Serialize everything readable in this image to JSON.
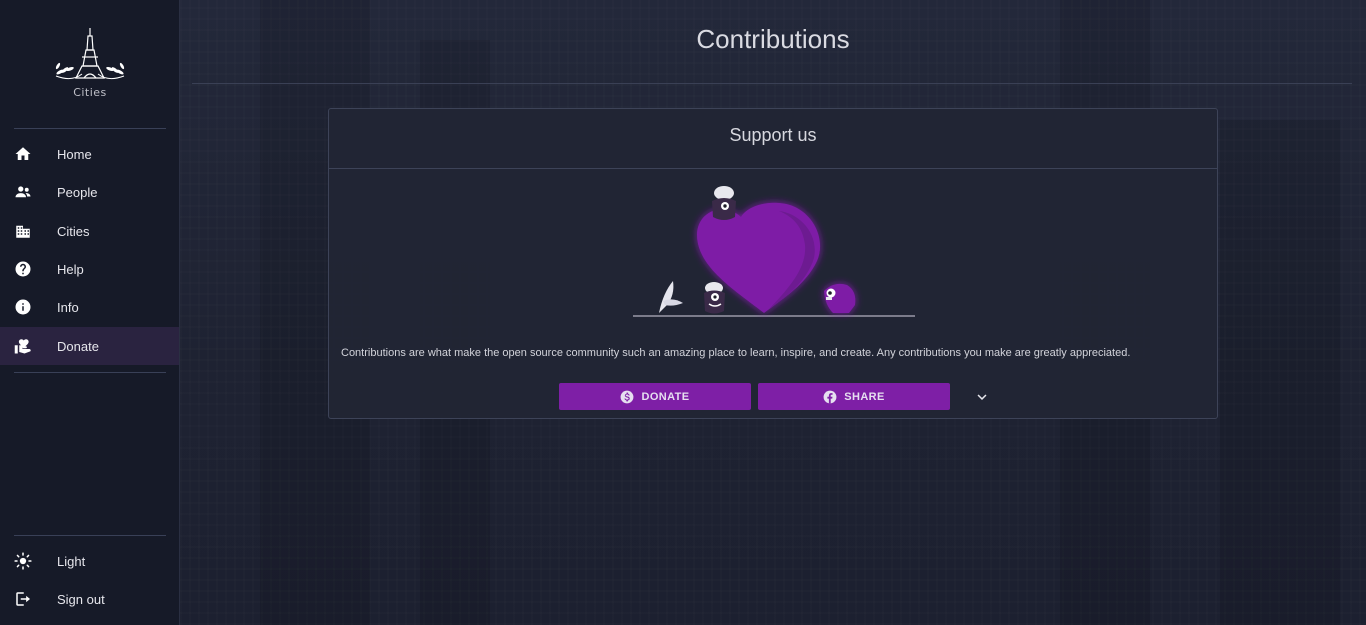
{
  "app": {
    "logo_text": "Cities"
  },
  "sidebar": {
    "items": [
      {
        "label": "Home",
        "icon": "home-icon"
      },
      {
        "label": "People",
        "icon": "people-icon"
      },
      {
        "label": "Cities",
        "icon": "city-icon"
      },
      {
        "label": "Help",
        "icon": "help-icon"
      },
      {
        "label": "Info",
        "icon": "info-icon"
      },
      {
        "label": "Donate",
        "icon": "donate-icon",
        "active": true
      }
    ],
    "bottom_items": [
      {
        "label": "Light",
        "icon": "sun-icon"
      },
      {
        "label": "Sign out",
        "icon": "sign-out-icon"
      }
    ]
  },
  "main": {
    "title": "Contributions",
    "card": {
      "title": "Support us",
      "text": "Contributions are what make the open source community such an amazing place to learn, inspire, and create. Any contributions you make are greatly appreciated.",
      "donate_label": "DONATE",
      "share_label": "SHARE"
    }
  },
  "colors": {
    "accent": "#7e1fa6",
    "sidebar_bg": "#161a28",
    "page_bg": "#1e2232",
    "active_item_bg": "#2a2340"
  }
}
